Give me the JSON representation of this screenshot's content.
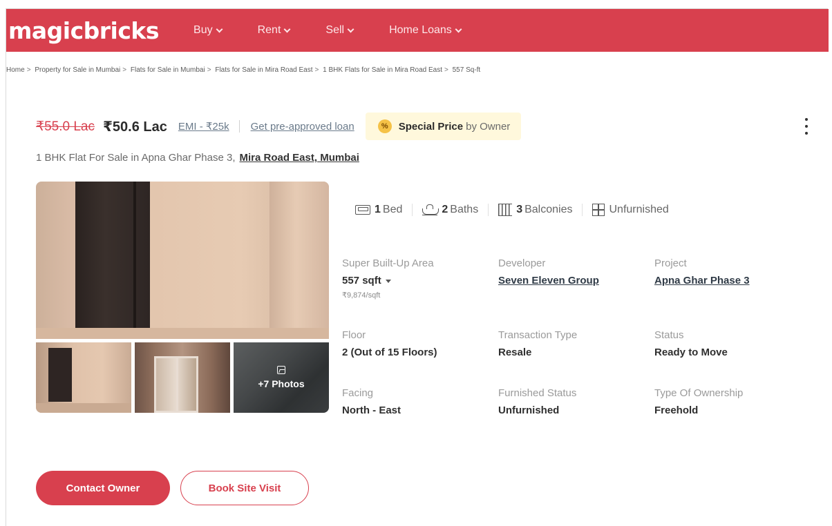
{
  "header": {
    "logo": "magicbricks",
    "nav": [
      {
        "label": "Buy"
      },
      {
        "label": "Rent"
      },
      {
        "label": "Sell"
      },
      {
        "label": "Home Loans"
      }
    ],
    "brand_color": "#d8404e"
  },
  "breadcrumb": [
    "Home",
    "Property for Sale in Mumbai",
    "Flats for Sale in Mumbai",
    "Flats for Sale in Mira Road East",
    "1 BHK Flats for Sale in Mira Road East",
    "557 Sq-ft"
  ],
  "breadcrumb_separator": ">",
  "price": {
    "original": "₹55.0 Lac",
    "current": "₹50.6 Lac",
    "emi": "EMI - ₹25k",
    "preapproved": "Get pre-approved loan",
    "badge_icon": "%",
    "badge_bold": "Special Price",
    "badge_rest": "by Owner"
  },
  "subtitle": {
    "text": "1 BHK Flat For Sale in Apna Ghar Phase 3,",
    "location": "Mira Road East, Mumbai"
  },
  "gallery": {
    "more_photos": "+7 Photos"
  },
  "features": [
    {
      "icon": "bed-icon",
      "count": "1",
      "label": "Bed"
    },
    {
      "icon": "bath-icon",
      "count": "2",
      "label": "Baths"
    },
    {
      "icon": "balcony-icon",
      "count": "3",
      "label": "Balconies"
    },
    {
      "icon": "furnishing-icon",
      "count": "",
      "label": "Unfurnished"
    }
  ],
  "details": {
    "area": {
      "label": "Super Built-Up Area",
      "value": "557 sqft",
      "sub": "₹9,874/sqft"
    },
    "developer": {
      "label": "Developer",
      "value": "Seven Eleven Group"
    },
    "project": {
      "label": "Project",
      "value": "Apna Ghar Phase 3"
    },
    "floor": {
      "label": "Floor",
      "value": "2 (Out of 15 Floors)"
    },
    "transaction": {
      "label": "Transaction Type",
      "value": "Resale"
    },
    "status": {
      "label": "Status",
      "value": "Ready to Move"
    },
    "facing": {
      "label": "Facing",
      "value": "North - East"
    },
    "furnished": {
      "label": "Furnished Status",
      "value": "Unfurnished"
    },
    "ownership": {
      "label": "Type Of Ownership",
      "value": "Freehold"
    }
  },
  "actions": {
    "contact": "Contact Owner",
    "visit": "Book Site Visit"
  }
}
